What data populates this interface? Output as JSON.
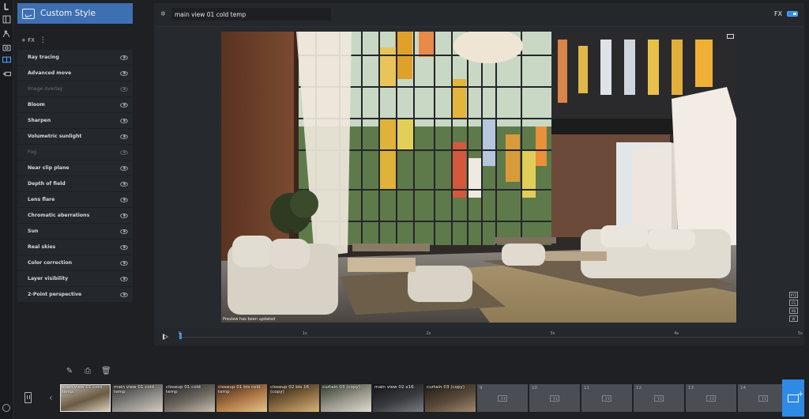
{
  "panel": {
    "style_title": "Custom Style",
    "add_fx_label": "+ FX",
    "fx_items": [
      {
        "label": "Ray tracing",
        "enabled": true
      },
      {
        "label": "Advanced move",
        "enabled": true
      },
      {
        "label": "Image overlay",
        "enabled": false
      },
      {
        "label": "Bloom",
        "enabled": true
      },
      {
        "label": "Sharpen",
        "enabled": true
      },
      {
        "label": "Volumetric sunlight",
        "enabled": true
      },
      {
        "label": "Fog",
        "enabled": false
      },
      {
        "label": "Near clip plane",
        "enabled": true
      },
      {
        "label": "Depth of field",
        "enabled": true
      },
      {
        "label": "Lens flare",
        "enabled": true
      },
      {
        "label": "Chromatic aberrations",
        "enabled": true
      },
      {
        "label": "Sun",
        "enabled": true
      },
      {
        "label": "Real skies",
        "enabled": true
      },
      {
        "label": "Color correction",
        "enabled": true
      },
      {
        "label": "Layer visibility",
        "enabled": true
      },
      {
        "label": "2-Point perspective",
        "enabled": true
      }
    ]
  },
  "viewport": {
    "view_name": "main view 01 cold temp",
    "fx_label": "FX",
    "fx_toggle_on": true,
    "preview_status": "Preview has been updated",
    "side_tags": [
      "PTZ",
      "FS",
      "PB",
      "W"
    ]
  },
  "timeline": {
    "ticks": [
      "0",
      "1s",
      "2s",
      "3s",
      "4s",
      "5s"
    ]
  },
  "strip": {
    "views": [
      {
        "label": "main view 01 cold temp",
        "selected": true
      },
      {
        "label": "main view 01 cold temp",
        "selected": false
      },
      {
        "label": "closeup 01 cold temp",
        "selected": false
      },
      {
        "label": "closeup 01 bis cold temp",
        "selected": false
      },
      {
        "label": "closeup 02 bis 16 (copy)",
        "selected": false
      },
      {
        "label": "curtain 03 (copy)",
        "selected": false
      },
      {
        "label": "main view 02 x16",
        "selected": false
      },
      {
        "label": "curtain 03 (copy)",
        "selected": false
      }
    ],
    "empty_slots": [
      "9",
      "10",
      "11",
      "12",
      "13",
      "14"
    ]
  },
  "colors": {
    "accent": "#2f8ae6",
    "header_blue": "#3f6fb3",
    "panel_bg": "#24272b",
    "app_bg": "#1e2024"
  }
}
